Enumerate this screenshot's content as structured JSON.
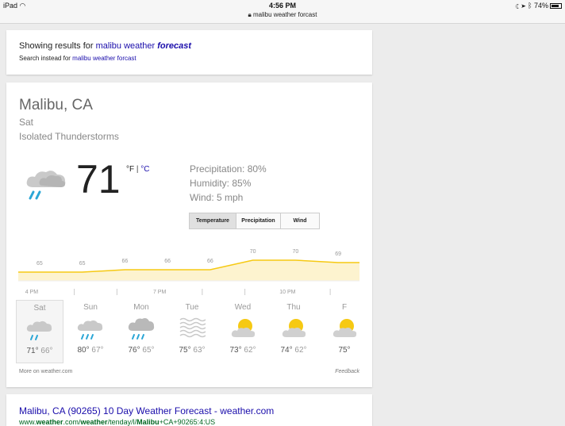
{
  "status": {
    "device": "iPad",
    "time": "4:56 PM",
    "url": "malibu weather forcast",
    "battery": "74%"
  },
  "correction": {
    "prefix": "Showing results for",
    "query_plain": "malibu weather",
    "query_emph": "forecast",
    "instead_prefix": "Search instead for",
    "instead_query": "malibu weather forcast"
  },
  "weather": {
    "location": "Malibu, CA",
    "day": "Sat",
    "condition": "Isolated Thunderstorms",
    "temp": "71",
    "unit_f": "°F",
    "unit_sep": "|",
    "unit_c": "°C",
    "precipitation": "Precipitation: 80%",
    "humidity": "Humidity: 85%",
    "wind": "Wind: 5 mph",
    "tabs": [
      "Temperature",
      "Precipitation",
      "Wind"
    ],
    "more_link": "More on weather.com",
    "feedback": "Feedback"
  },
  "chart_data": {
    "type": "area",
    "x": [
      "",
      "",
      "",
      "",
      "",
      "",
      "",
      ""
    ],
    "values": [
      65,
      65,
      66,
      66,
      66,
      70,
      70,
      69
    ],
    "tick_labels": [
      "4 PM",
      "",
      "",
      "7 PM",
      "",
      "",
      "10 PM",
      ""
    ],
    "color": "#f6c913"
  },
  "forecast": [
    {
      "day": "Sat",
      "hi": "71°",
      "lo": "66°",
      "icon": "thunderstorm-icon"
    },
    {
      "day": "Sun",
      "hi": "80°",
      "lo": "67°",
      "icon": "partly-cloudy-rain-icon"
    },
    {
      "day": "Mon",
      "hi": "76°",
      "lo": "65°",
      "icon": "rain-icon"
    },
    {
      "day": "Tue",
      "hi": "75°",
      "lo": "63°",
      "icon": "fog-icon"
    },
    {
      "day": "Wed",
      "hi": "73°",
      "lo": "62°",
      "icon": "partly-sunny-icon"
    },
    {
      "day": "Thu",
      "hi": "74°",
      "lo": "62°",
      "icon": "partly-sunny-icon"
    },
    {
      "day": "F",
      "hi": "75°",
      "lo": "",
      "icon": "partly-sunny-icon"
    }
  ],
  "result": {
    "title": "Malibu, CA (90265) 10 Day Weather Forecast - weather.com",
    "url_parts": [
      "www.",
      "weather",
      ".com/",
      "weather",
      "/tenday/l/",
      "Malibu",
      "+CA+90265:4:US"
    ]
  }
}
